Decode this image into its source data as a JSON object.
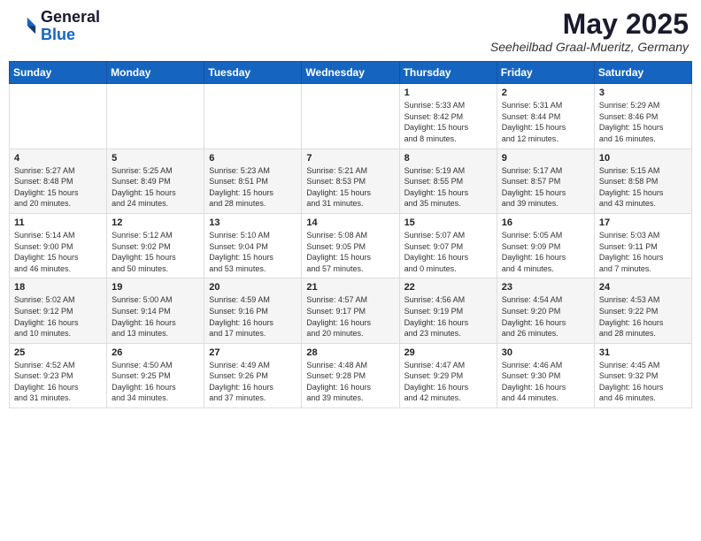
{
  "header": {
    "logo_general": "General",
    "logo_blue": "Blue",
    "month_title": "May 2025",
    "subtitle": "Seeheilbad Graal-Mueritz, Germany"
  },
  "weekdays": [
    "Sunday",
    "Monday",
    "Tuesday",
    "Wednesday",
    "Thursday",
    "Friday",
    "Saturday"
  ],
  "weeks": [
    [
      {
        "day": "",
        "info": ""
      },
      {
        "day": "",
        "info": ""
      },
      {
        "day": "",
        "info": ""
      },
      {
        "day": "",
        "info": ""
      },
      {
        "day": "1",
        "info": "Sunrise: 5:33 AM\nSunset: 8:42 PM\nDaylight: 15 hours\nand 8 minutes."
      },
      {
        "day": "2",
        "info": "Sunrise: 5:31 AM\nSunset: 8:44 PM\nDaylight: 15 hours\nand 12 minutes."
      },
      {
        "day": "3",
        "info": "Sunrise: 5:29 AM\nSunset: 8:46 PM\nDaylight: 15 hours\nand 16 minutes."
      }
    ],
    [
      {
        "day": "4",
        "info": "Sunrise: 5:27 AM\nSunset: 8:48 PM\nDaylight: 15 hours\nand 20 minutes."
      },
      {
        "day": "5",
        "info": "Sunrise: 5:25 AM\nSunset: 8:49 PM\nDaylight: 15 hours\nand 24 minutes."
      },
      {
        "day": "6",
        "info": "Sunrise: 5:23 AM\nSunset: 8:51 PM\nDaylight: 15 hours\nand 28 minutes."
      },
      {
        "day": "7",
        "info": "Sunrise: 5:21 AM\nSunset: 8:53 PM\nDaylight: 15 hours\nand 31 minutes."
      },
      {
        "day": "8",
        "info": "Sunrise: 5:19 AM\nSunset: 8:55 PM\nDaylight: 15 hours\nand 35 minutes."
      },
      {
        "day": "9",
        "info": "Sunrise: 5:17 AM\nSunset: 8:57 PM\nDaylight: 15 hours\nand 39 minutes."
      },
      {
        "day": "10",
        "info": "Sunrise: 5:15 AM\nSunset: 8:58 PM\nDaylight: 15 hours\nand 43 minutes."
      }
    ],
    [
      {
        "day": "11",
        "info": "Sunrise: 5:14 AM\nSunset: 9:00 PM\nDaylight: 15 hours\nand 46 minutes."
      },
      {
        "day": "12",
        "info": "Sunrise: 5:12 AM\nSunset: 9:02 PM\nDaylight: 15 hours\nand 50 minutes."
      },
      {
        "day": "13",
        "info": "Sunrise: 5:10 AM\nSunset: 9:04 PM\nDaylight: 15 hours\nand 53 minutes."
      },
      {
        "day": "14",
        "info": "Sunrise: 5:08 AM\nSunset: 9:05 PM\nDaylight: 15 hours\nand 57 minutes."
      },
      {
        "day": "15",
        "info": "Sunrise: 5:07 AM\nSunset: 9:07 PM\nDaylight: 16 hours\nand 0 minutes."
      },
      {
        "day": "16",
        "info": "Sunrise: 5:05 AM\nSunset: 9:09 PM\nDaylight: 16 hours\nand 4 minutes."
      },
      {
        "day": "17",
        "info": "Sunrise: 5:03 AM\nSunset: 9:11 PM\nDaylight: 16 hours\nand 7 minutes."
      }
    ],
    [
      {
        "day": "18",
        "info": "Sunrise: 5:02 AM\nSunset: 9:12 PM\nDaylight: 16 hours\nand 10 minutes."
      },
      {
        "day": "19",
        "info": "Sunrise: 5:00 AM\nSunset: 9:14 PM\nDaylight: 16 hours\nand 13 minutes."
      },
      {
        "day": "20",
        "info": "Sunrise: 4:59 AM\nSunset: 9:16 PM\nDaylight: 16 hours\nand 17 minutes."
      },
      {
        "day": "21",
        "info": "Sunrise: 4:57 AM\nSunset: 9:17 PM\nDaylight: 16 hours\nand 20 minutes."
      },
      {
        "day": "22",
        "info": "Sunrise: 4:56 AM\nSunset: 9:19 PM\nDaylight: 16 hours\nand 23 minutes."
      },
      {
        "day": "23",
        "info": "Sunrise: 4:54 AM\nSunset: 9:20 PM\nDaylight: 16 hours\nand 26 minutes."
      },
      {
        "day": "24",
        "info": "Sunrise: 4:53 AM\nSunset: 9:22 PM\nDaylight: 16 hours\nand 28 minutes."
      }
    ],
    [
      {
        "day": "25",
        "info": "Sunrise: 4:52 AM\nSunset: 9:23 PM\nDaylight: 16 hours\nand 31 minutes."
      },
      {
        "day": "26",
        "info": "Sunrise: 4:50 AM\nSunset: 9:25 PM\nDaylight: 16 hours\nand 34 minutes."
      },
      {
        "day": "27",
        "info": "Sunrise: 4:49 AM\nSunset: 9:26 PM\nDaylight: 16 hours\nand 37 minutes."
      },
      {
        "day": "28",
        "info": "Sunrise: 4:48 AM\nSunset: 9:28 PM\nDaylight: 16 hours\nand 39 minutes."
      },
      {
        "day": "29",
        "info": "Sunrise: 4:47 AM\nSunset: 9:29 PM\nDaylight: 16 hours\nand 42 minutes."
      },
      {
        "day": "30",
        "info": "Sunrise: 4:46 AM\nSunset: 9:30 PM\nDaylight: 16 hours\nand 44 minutes."
      },
      {
        "day": "31",
        "info": "Sunrise: 4:45 AM\nSunset: 9:32 PM\nDaylight: 16 hours\nand 46 minutes."
      }
    ]
  ]
}
